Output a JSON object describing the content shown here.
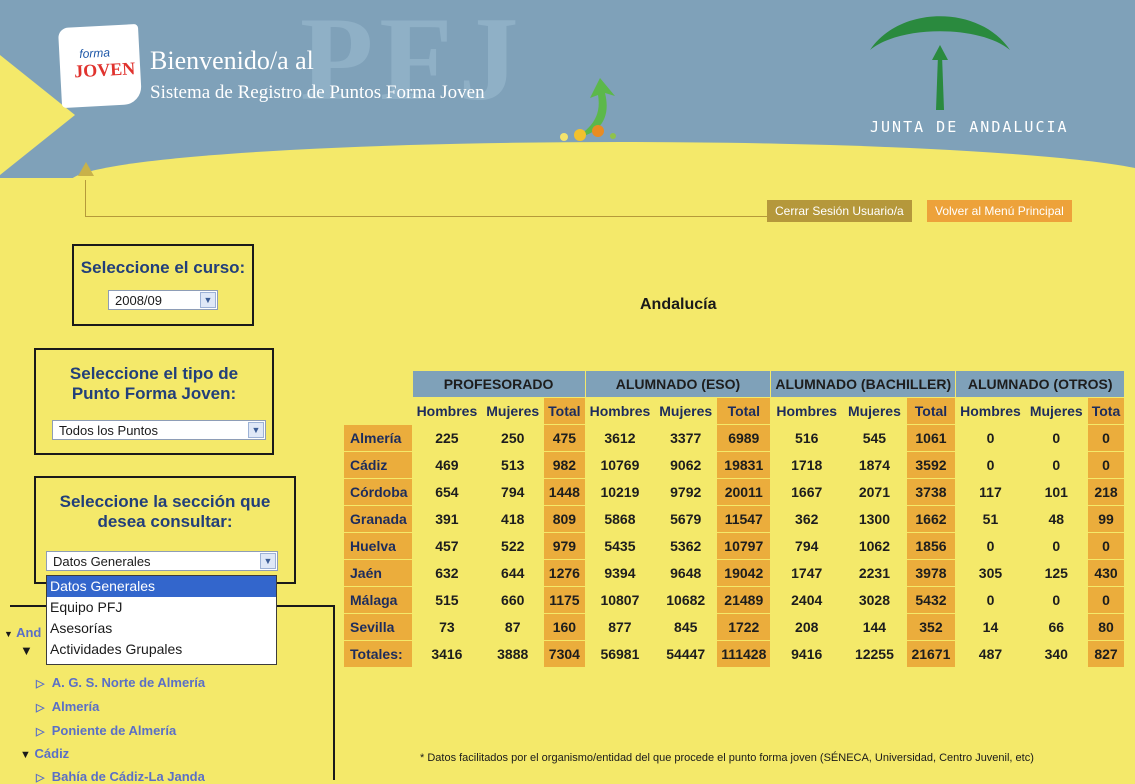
{
  "header": {
    "logo_line1": "forma",
    "logo_line2": "JOVEN",
    "watermark": "PFJ",
    "welcome": "Bienvenido/a al",
    "subtitle": "Sistema de Registro de Puntos Forma Joven",
    "junta": "JUNTA DE ANDALUCIA"
  },
  "top_buttons": {
    "logout": "Cerrar Sesión Usuario/a",
    "main_menu": "Volver al Menú Principal"
  },
  "curso": {
    "label": "Seleccione el curso:",
    "value": "2008/09"
  },
  "tipo": {
    "label": "Seleccione el tipo de Punto Forma Joven:",
    "value": "Todos los Puntos"
  },
  "seccion": {
    "label": "Seleccione la sección que desea consultar:",
    "value": "Datos Generales",
    "options": [
      "Datos Generales",
      "Equipo PFJ",
      "Asesorías",
      "Actividades Grupales"
    ]
  },
  "tree": {
    "root": "And",
    "items": [
      "A. G. S. Norte de Almería",
      "Almería",
      "Poniente de Almería"
    ],
    "cadiz": "Cádiz",
    "next": "Bahía de Cádiz-La Janda"
  },
  "region": "Andalucía",
  "table": {
    "groups": [
      "PROFESORADO",
      "ALUMNADO (ESO)",
      "ALUMNADO (BACHILLER)",
      "ALUMNADO (OTROS)"
    ],
    "subheaders": [
      "Hombres",
      "Mujeres",
      "Total",
      "Hombres",
      "Mujeres",
      "Total",
      "Hombres",
      "Mujeres",
      "Total",
      "Hombres",
      "Mujeres",
      "Tota"
    ],
    "rows": [
      {
        "name": "Almería",
        "values": [
          "225",
          "250",
          "475",
          "3612",
          "3377",
          "6989",
          "516",
          "545",
          "1061",
          "0",
          "0",
          "0"
        ]
      },
      {
        "name": "Cádiz",
        "values": [
          "469",
          "513",
          "982",
          "10769",
          "9062",
          "19831",
          "1718",
          "1874",
          "3592",
          "0",
          "0",
          "0"
        ]
      },
      {
        "name": "Córdoba",
        "values": [
          "654",
          "794",
          "1448",
          "10219",
          "9792",
          "20011",
          "1667",
          "2071",
          "3738",
          "117",
          "101",
          "218"
        ]
      },
      {
        "name": "Granada",
        "values": [
          "391",
          "418",
          "809",
          "5868",
          "5679",
          "11547",
          "362",
          "1300",
          "1662",
          "51",
          "48",
          "99"
        ]
      },
      {
        "name": "Huelva",
        "values": [
          "457",
          "522",
          "979",
          "5435",
          "5362",
          "10797",
          "794",
          "1062",
          "1856",
          "0",
          "0",
          "0"
        ]
      },
      {
        "name": "Jaén",
        "values": [
          "632",
          "644",
          "1276",
          "9394",
          "9648",
          "19042",
          "1747",
          "2231",
          "3978",
          "305",
          "125",
          "430"
        ]
      },
      {
        "name": "Málaga",
        "values": [
          "515",
          "660",
          "1175",
          "10807",
          "10682",
          "21489",
          "2404",
          "3028",
          "5432",
          "0",
          "0",
          "0"
        ]
      },
      {
        "name": "Sevilla",
        "values": [
          "73",
          "87",
          "160",
          "877",
          "845",
          "1722",
          "208",
          "144",
          "352",
          "14",
          "66",
          "80"
        ]
      },
      {
        "name": "Totales:",
        "values": [
          "3416",
          "3888",
          "7304",
          "56981",
          "54447",
          "111428",
          "9416",
          "12255",
          "21671",
          "487",
          "340",
          "827"
        ]
      }
    ]
  },
  "footnote": "* Datos facilitados por el organismo/entidad del que procede el punto forma joven (SÉNECA, Universidad, Centro Juvenil, etc)",
  "colors": {
    "header": "#7fa1b9",
    "background": "#f4e96a",
    "accent": "#ebad3c",
    "logout_btn": "#b5983b",
    "menu_btn": "#eda23a"
  }
}
